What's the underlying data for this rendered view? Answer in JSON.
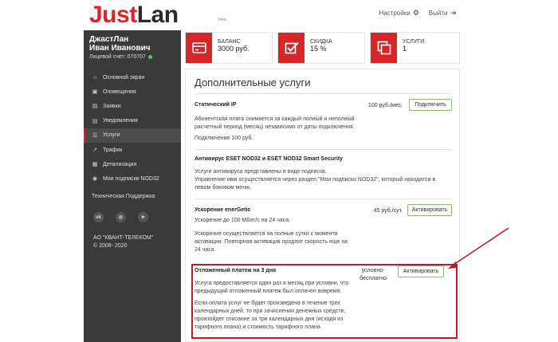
{
  "header": {
    "logo_red": "Just",
    "logo_dark": "Lan",
    "logo_beta": "beta",
    "settings_label": "Настройки",
    "logout_label": "Выйти"
  },
  "sidebar": {
    "user_line1": "ДжастЛан",
    "user_line2": "Иван Иванович",
    "account_label": "Лицевой счет: 070707",
    "items": [
      {
        "label": "Основной экран",
        "icon": "home-icon"
      },
      {
        "label": "Оповещения",
        "icon": "inbox-icon"
      },
      {
        "label": "Заявки",
        "icon": "file-icon"
      },
      {
        "label": "Уведомления",
        "icon": "file-icon"
      },
      {
        "label": "Услуги",
        "icon": "list-icon"
      },
      {
        "label": "Трафик",
        "icon": "chart-icon"
      },
      {
        "label": "Детализация",
        "icon": "calendar-icon"
      },
      {
        "label": "Мои подписки NOD32",
        "icon": "eye-icon"
      }
    ],
    "support_label": "Техническая Поддержка",
    "social": [
      "vk",
      "instagram",
      "telegram"
    ],
    "company_line1": "АО \"КВАНТ-ТЕЛЕКОМ\"",
    "company_line2": "© 2008- 2020"
  },
  "cards": [
    {
      "label": "БАЛАНС",
      "value": "3000 руб.",
      "icon": "credit-card-icon"
    },
    {
      "label": "СКИДКА",
      "value": "15 %",
      "icon": "checkbox-icon"
    },
    {
      "label": "УСЛУГИ",
      "value": "1",
      "icon": "copy-icon"
    }
  ],
  "panel": {
    "title": "Дополнительные услуги",
    "services": [
      {
        "name": "Статический IP",
        "price": "100 руб./мес.",
        "button": "Подключить",
        "desc": [
          "Абонентская плата снимается за каждый полный и неполный",
          "расчетный период (месяц) независимо от даты подключения."
        ],
        "desc2": [
          "Подключение 100 руб."
        ]
      },
      {
        "name": "Антивирус ESET NOD32 и ESET NOD32 Smart Security",
        "desc": [
          "Услуги антивируса представлены в виде подписок.",
          "Управление ими осуществляется через раздел \"Мои подписки NOD32\", который находится в",
          "левом боковом меню."
        ]
      },
      {
        "name": "Ускорение enerGetic",
        "price": "45 руб./сут.",
        "button": "Активировать",
        "desc": [
          "Ускорение до 100 Мбит/с на 24 часа."
        ],
        "desc2": [
          "Ускорение осуществляется на полные сутки с момента",
          "активации. Повторная активация продлит скорость еще на",
          "24 часа"
        ]
      },
      {
        "name": "Отложенный платеж на 3 дня",
        "price_line1": "условно-",
        "price_line2": "бесплатно",
        "button": "Активировать",
        "desc": [
          "Услуга предоставляется один раз в месяц при условии, что",
          "предыдущий отложенный платеж был оплачен вовремя."
        ],
        "desc2": [
          "Если оплата услуг не будет произведена в течение трех",
          "календарных дней, то при зачислении денежных средств,",
          "произойдет списание за три календарных дня (исходя из",
          "тарифного плана) и стоимость тарифного плана"
        ]
      }
    ]
  },
  "colors": {
    "brand_red": "#d7262a",
    "sidebar_bg": "#3a3a3a",
    "button_border": "#8db86d",
    "highlight": "#b81f23"
  }
}
